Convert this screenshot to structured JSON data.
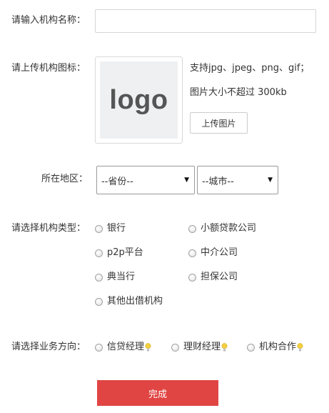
{
  "name_field": {
    "label": "请输入机构名称：",
    "value": ""
  },
  "logo_field": {
    "label": "请上传机构图标：",
    "placeholder_text": "logo",
    "hint_formats": "支持jpg、jpeg、png、gif；",
    "hint_size": "图片大小不超过 300kb",
    "upload_button": "上传图片"
  },
  "region": {
    "label": "所在地区：",
    "province": "--省份--",
    "city": "--城市--"
  },
  "org_type": {
    "label": "请选择机构类型：",
    "options": [
      "银行",
      "小额贷款公司",
      "p2p平台",
      "中介公司",
      "典当行",
      "担保公司",
      "其他出借机构"
    ]
  },
  "business": {
    "label": "请选择业务方向：",
    "options": [
      "信贷经理",
      "理财经理",
      "机构合作"
    ]
  },
  "submit_label": "完成",
  "colors": {
    "accent": "#e04543",
    "bulb": "#f4d03f"
  },
  "icons": {
    "dropdown": "triangle-down",
    "hint": "lightbulb-icon"
  }
}
